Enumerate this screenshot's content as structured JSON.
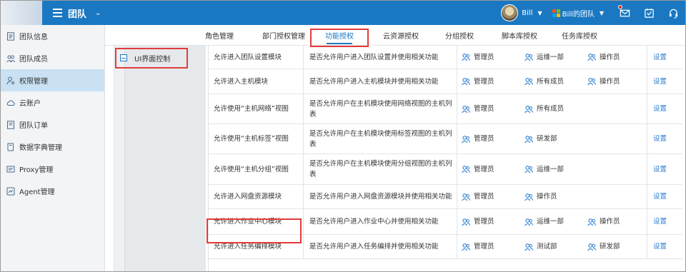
{
  "header": {
    "title": "团队",
    "user": "Bill",
    "team": "Bill的团队",
    "accent": "#1a78c2"
  },
  "sidebar": {
    "items": [
      {
        "label": "团队信息",
        "icon": "id-card-icon"
      },
      {
        "label": "团队成员",
        "icon": "users-icon"
      },
      {
        "label": "权限管理",
        "icon": "user-key-icon",
        "active": true
      },
      {
        "label": "云账户",
        "icon": "cloud-icon"
      },
      {
        "label": "团队订单",
        "icon": "order-icon"
      },
      {
        "label": "数据字典管理",
        "icon": "book-icon"
      },
      {
        "label": "Proxy管理",
        "icon": "proxy-icon"
      },
      {
        "label": "Agent管理",
        "icon": "agent-icon"
      }
    ]
  },
  "tabs": [
    {
      "label": "角色管理"
    },
    {
      "label": "部门授权管理"
    },
    {
      "label": "功能授权",
      "active": true
    },
    {
      "label": "云资源授权"
    },
    {
      "label": "分组授权"
    },
    {
      "label": "脚本库授权"
    },
    {
      "label": "任务库授权"
    }
  ],
  "tree": {
    "node_label": "UI界面控制"
  },
  "table": {
    "setting_label": "设置",
    "rows": [
      {
        "name": "允许进入团队设置模块",
        "desc": "是否允许用户进入团队设置并使用相关功能",
        "roles": [
          "管理员",
          "运维一部",
          "操作员"
        ]
      },
      {
        "name": "允许进入主机模块",
        "desc": "是否允许用户进入主机模块并使用相关功能",
        "roles": [
          "管理员",
          "所有成员",
          "操作员"
        ]
      },
      {
        "name": "允许使用“主机网络”视图",
        "desc": "是否允许用户在主机模块使用网络视图的主机列表",
        "roles": [
          "管理员",
          "所有成员"
        ]
      },
      {
        "name": "允许使用“主机标签”视图",
        "desc": "是否允许用户在主机模块使用标签视图的主机列表",
        "roles": [
          "管理员",
          "研发部"
        ]
      },
      {
        "name": "允许使用“主机分组”视图",
        "desc": "是否允许用户在主机模块使用分组视图的主机列表",
        "roles": [
          "管理员",
          "运维一部"
        ]
      },
      {
        "name": "允许进入网盘资源模块",
        "desc": "是否允许用户进入网盘资源模块并使用相关功能",
        "roles": [
          "管理员",
          "操作员"
        ]
      },
      {
        "name": "允许进入作业中心模块",
        "desc": "是否允许用户进入作业中心并使用相关功能",
        "roles": [
          "管理员",
          "运维一部",
          "操作员"
        ]
      },
      {
        "name": "允许进入任务编排模块",
        "desc": "是否允许用户进入任务编排并使用相关功能",
        "roles": [
          "管理员",
          "测试部",
          "研发部"
        ]
      }
    ]
  }
}
